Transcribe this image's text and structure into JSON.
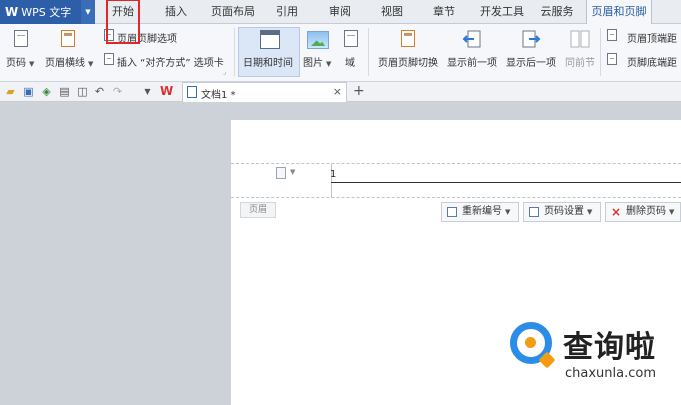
{
  "app": {
    "logo_text": "W",
    "title": "WPS 文字"
  },
  "menu": {
    "tabs": [
      {
        "label": "开始"
      },
      {
        "label": "插入"
      },
      {
        "label": "页面布局"
      },
      {
        "label": "引用"
      },
      {
        "label": "审阅"
      },
      {
        "label": "视图"
      },
      {
        "label": "章节"
      },
      {
        "label": "开发工具"
      },
      {
        "label": "云服务"
      },
      {
        "label": "页眉和页脚"
      }
    ],
    "active_tab": "页眉和页脚",
    "highlighted_tab": "开始"
  },
  "ribbon": {
    "page_number": "页码",
    "header_line": "页眉横线",
    "header_footer_options": "页眉页脚选项",
    "insert_align": "插入 “对齐方式” 选项卡",
    "date_time": "日期和时间",
    "picture": "图片",
    "field": "域",
    "switch": "页眉页脚切换",
    "show_prev": "显示前一项",
    "show_next": "显示后一项",
    "same_prev": "同前节",
    "header_top_distance": "页眉顶端距",
    "footer_bottom_distance": "页脚底端距"
  },
  "toolbar": {
    "doc_tab": "文档1 *",
    "close_glyph": "×",
    "add_glyph": "+"
  },
  "document": {
    "header_text": "1",
    "header_label": "页眉",
    "btn_renumber": "重新编号",
    "btn_page_settings": "页码设置",
    "btn_delete_page_number": "删除页码"
  },
  "watermark": {
    "name": "查询啦",
    "domain": "chaxunla.com"
  },
  "colors": {
    "brand": "#2d5ea8",
    "highlight": "#e0282a",
    "accent_orange": "#e38b39"
  }
}
